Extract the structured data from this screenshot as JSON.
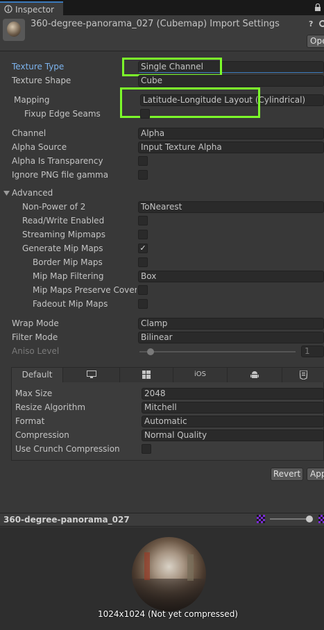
{
  "tab": {
    "title": "Inspector"
  },
  "header": {
    "title": "360-degree-panorama_027 (Cubemap) Import Settings",
    "open_label": "Ope"
  },
  "fields": {
    "texture_type": {
      "label": "Texture Type",
      "value": "Single Channel"
    },
    "texture_shape": {
      "label": "Texture Shape",
      "value": "Cube"
    },
    "mapping": {
      "label": "Mapping",
      "value": "Latitude-Longitude Layout (Cylindrical)"
    },
    "fixup_edge_seams": {
      "label": "Fixup Edge Seams",
      "checked": false
    },
    "channel": {
      "label": "Channel",
      "value": "Alpha"
    },
    "alpha_source": {
      "label": "Alpha Source",
      "value": "Input Texture Alpha"
    },
    "alpha_is_transparency": {
      "label": "Alpha Is Transparency",
      "checked": false
    },
    "ignore_png_gamma": {
      "label": "Ignore PNG file gamma",
      "checked": false
    }
  },
  "advanced": {
    "label": "Advanced",
    "non_power_of_2": {
      "label": "Non-Power of 2",
      "value": "ToNearest"
    },
    "read_write": {
      "label": "Read/Write Enabled",
      "checked": false
    },
    "streaming_mipmaps": {
      "label": "Streaming Mipmaps",
      "checked": false
    },
    "generate_mip_maps": {
      "label": "Generate Mip Maps",
      "checked": true,
      "check_glyph": "✓"
    },
    "border_mip_maps": {
      "label": "Border Mip Maps",
      "checked": false
    },
    "mip_map_filtering": {
      "label": "Mip Map Filtering",
      "value": "Box"
    },
    "mip_maps_preserve_coverage": {
      "label": "Mip Maps Preserve Covera",
      "checked": false
    },
    "fadeout_mip_maps": {
      "label": "Fadeout Mip Maps",
      "checked": false
    }
  },
  "wrap_mode": {
    "label": "Wrap Mode",
    "value": "Clamp"
  },
  "filter_mode": {
    "label": "Filter Mode",
    "value": "Bilinear"
  },
  "aniso_level": {
    "label": "Aniso Level",
    "value": "1",
    "slider_fraction": 0.0
  },
  "platform": {
    "tabs": [
      {
        "label": "Default",
        "icon": ""
      },
      {
        "label": "",
        "icon": "monitor-icon"
      },
      {
        "label": "",
        "icon": "windows-icon"
      },
      {
        "label": "iOS",
        "icon": ""
      },
      {
        "label": "",
        "icon": "android-icon"
      },
      {
        "label": "",
        "icon": "html5-icon"
      }
    ],
    "max_size": {
      "label": "Max Size",
      "value": "2048"
    },
    "resize_algorithm": {
      "label": "Resize Algorithm",
      "value": "Mitchell"
    },
    "format": {
      "label": "Format",
      "value": "Automatic"
    },
    "compression": {
      "label": "Compression",
      "value": "Normal Quality"
    },
    "use_crunch": {
      "label": "Use Crunch Compression",
      "checked": false
    }
  },
  "buttons": {
    "revert": "Revert",
    "apply": "App"
  },
  "preview": {
    "title": "360-degree-panorama_027",
    "info": "1024x1024 (Not yet compressed)"
  },
  "colors": {
    "highlight": "#7cfc2a",
    "accent_blue": "#3a79bb",
    "label_blue": "#7db4ee"
  }
}
